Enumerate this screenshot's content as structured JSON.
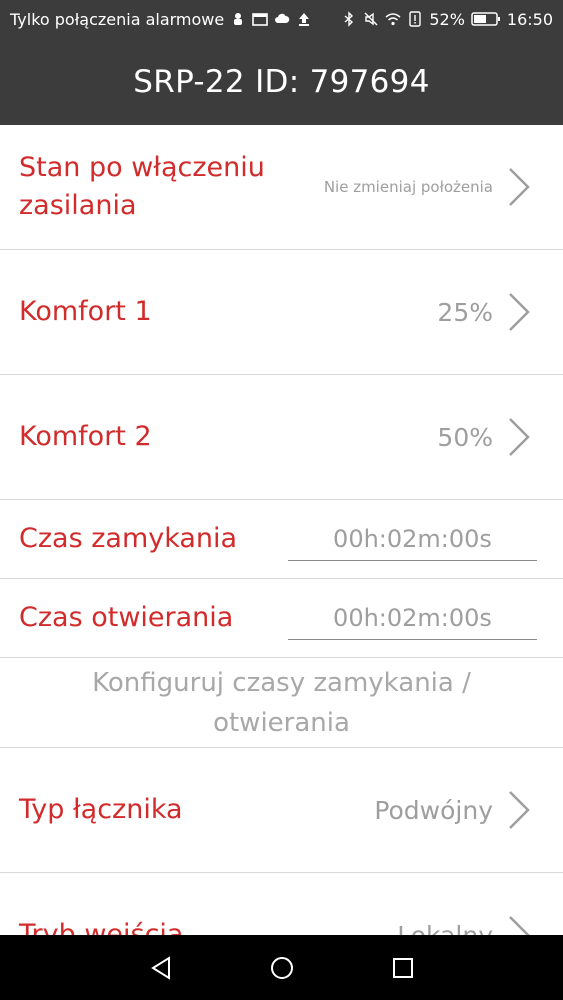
{
  "status_bar": {
    "carrier": "Tylko połączenia alarmowe",
    "battery_percent": "52%",
    "time": "16:50",
    "left_icons": [
      "usb-debug-icon",
      "gallery-icon",
      "cloud-icon",
      "upload-icon"
    ],
    "right_icons": [
      "bluetooth-icon",
      "mute-icon",
      "wifi-icon",
      "alert-icon",
      "battery-icon"
    ]
  },
  "app_bar": {
    "title": "SRP-22 ID: 797694"
  },
  "settings": {
    "power_on_state": {
      "label": "Stan po włączeniu zasilania",
      "value": "Nie zmieniaj położenia"
    },
    "comfort1": {
      "label": "Komfort 1",
      "value": "25%"
    },
    "comfort2": {
      "label": "Komfort 2",
      "value": "50%"
    },
    "closing_time": {
      "label": "Czas zamykania",
      "value": "00h:02m:00s"
    },
    "opening_time": {
      "label": "Czas otwierania",
      "value": "00h:02m:00s"
    },
    "configure_times": {
      "label": "Konfiguruj czasy zamykania / otwierania"
    },
    "switch_type": {
      "label": "Typ łącznika",
      "value": "Podwójny"
    },
    "input_mode": {
      "label": "Tryb wejścia",
      "value": "Lokalny"
    }
  },
  "colors": {
    "label_red": "#d22b2b",
    "value_gray": "#9e9e9e",
    "bar_dark": "#3c3c3c",
    "nav_black": "#000000"
  },
  "nav_bar": {
    "buttons": [
      "back-icon",
      "home-icon",
      "recents-icon"
    ]
  }
}
